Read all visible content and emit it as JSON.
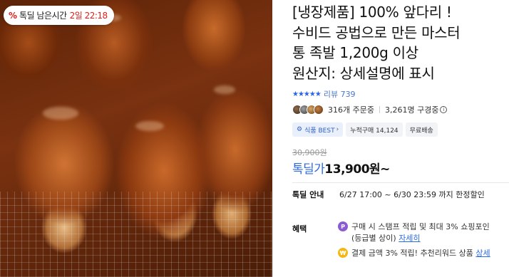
{
  "image": {
    "timer_badge": {
      "icon": "percent-tag-icon",
      "label": "톡딜 남은시간",
      "value": "2일 22:18",
      "accent": "#e0201b"
    }
  },
  "product": {
    "title_lines": [
      "[냉장제품] 100% 앞다리 !",
      "수비드 공법으로 만든 마스터",
      "통 족발 1,200g 이상",
      "원산지: 상세설명에 표시"
    ],
    "rating": {
      "stars": "★★★★★",
      "review_link": "리뷰 739",
      "star_color": "#2a65e6"
    },
    "stats": {
      "ordering": "316개 주문중",
      "subscribers": "3,261명 구경중",
      "info_icon": "i"
    },
    "chips": {
      "best": "식품 BEST",
      "best_caret": "›",
      "cumulative": "누적구매 14,124",
      "shipping": "무료배송"
    },
    "price": {
      "original": "30,900원",
      "deal_label": "톡딜가",
      "sale": "13,900원~",
      "accent": "#2d6be0"
    },
    "deal_info": {
      "label": "톡딜 안내",
      "value": "6/27 17:00 ~ 6/30 23:59 까지 한정할인"
    },
    "benefits": {
      "label": "혜택",
      "items": [
        {
          "icon": "P",
          "line1": "구매 시 스탬프 적립 및 최대 3% 쇼핑포인",
          "line2_prefix": "(등급별 상이)",
          "line2_link": "자세히"
        },
        {
          "icon": "₩",
          "line1_prefix": "결제 금액 3% 적립! 추천리워드 상품",
          "line1_link": "상세"
        }
      ]
    }
  }
}
